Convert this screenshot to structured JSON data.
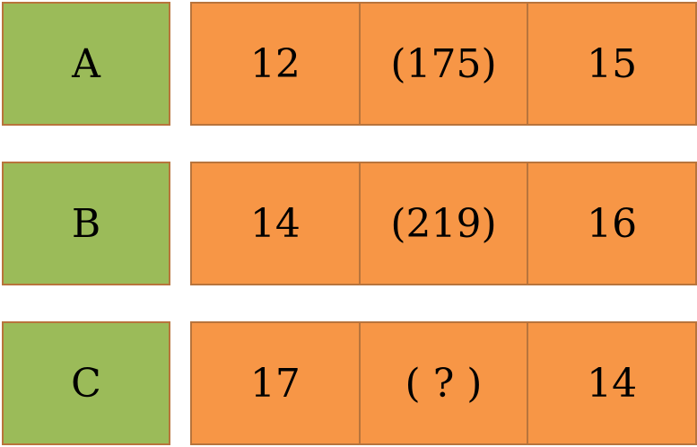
{
  "rows": [
    {
      "label": "A",
      "cells": [
        "12",
        "(175)",
        "15"
      ]
    },
    {
      "label": "B",
      "cells": [
        "14",
        "(219)",
        "16"
      ]
    },
    {
      "label": "C",
      "cells": [
        "17",
        "( ? )",
        "14"
      ]
    }
  ],
  "colors": {
    "label_fill": "#9bbb59",
    "cell_fill": "#f79646",
    "border": "#b8743c"
  }
}
